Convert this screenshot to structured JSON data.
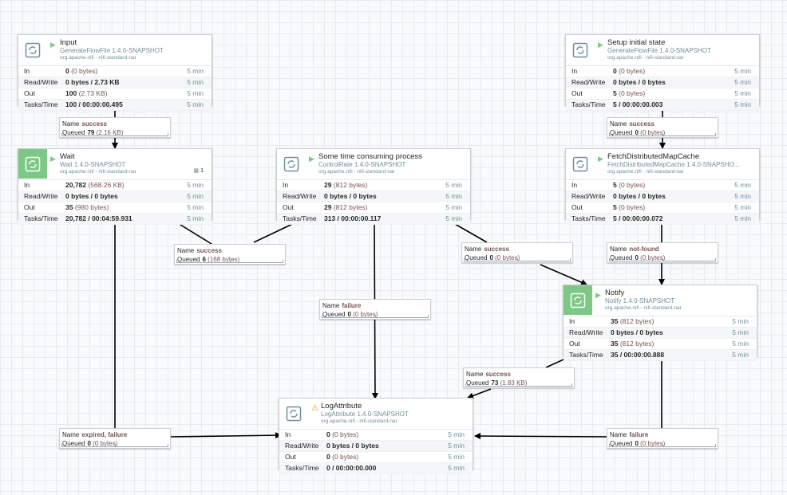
{
  "processors": {
    "input": {
      "name": "Input",
      "type": "GenerateFlowFile 1.4.0-SNAPSHOT",
      "bundle": "org.apache.nifi - nifi-standard-nar",
      "state": "running",
      "stats": [
        {
          "label": "In",
          "value": "0",
          "sub": "(0 bytes)",
          "time": "5 min"
        },
        {
          "label": "Read/Write",
          "value": "0 bytes / 2.73 KB",
          "sub": "",
          "time": "5 min"
        },
        {
          "label": "Out",
          "value": "100",
          "sub": "(2.73 KB)",
          "time": "5 min"
        },
        {
          "label": "Tasks/Time",
          "value": "100 / 00:00:00.495",
          "sub": "",
          "time": "5 min"
        }
      ]
    },
    "setup": {
      "name": "Setup initial state",
      "type": "GenerateFlowFile 1.4.0-SNAPSHOT",
      "bundle": "org.apache.nifi - nifi-standard-nar",
      "state": "running",
      "stats": [
        {
          "label": "In",
          "value": "0",
          "sub": "(0 bytes)",
          "time": "5 min"
        },
        {
          "label": "Read/Write",
          "value": "0 bytes / 0 bytes",
          "sub": "",
          "time": "5 min"
        },
        {
          "label": "Out",
          "value": "5",
          "sub": "(0 bytes)",
          "time": "5 min"
        },
        {
          "label": "Tasks/Time",
          "value": "5 / 00:00:00.003",
          "sub": "",
          "time": "5 min"
        }
      ]
    },
    "wait": {
      "name": "Wait",
      "type": "Wait 1.4.0-SNAPSHOT",
      "bundle": "org.apache.nifi - nifi-standard-nar",
      "state": "running",
      "badge": "1",
      "stats": [
        {
          "label": "In",
          "value": "20,782",
          "sub": "(568.26 KB)",
          "time": "5 min"
        },
        {
          "label": "Read/Write",
          "value": "0 bytes / 0 bytes",
          "sub": "",
          "time": "5 min"
        },
        {
          "label": "Out",
          "value": "35",
          "sub": "(980 bytes)",
          "time": "5 min"
        },
        {
          "label": "Tasks/Time",
          "value": "20,782 / 00:04:59.931",
          "sub": "",
          "time": "5 min"
        }
      ]
    },
    "consume": {
      "name": "Some time consuming process",
      "type": "ControlRate 1.4.0-SNAPSHOT",
      "bundle": "org.apache.nifi - nifi-standard-nar",
      "state": "running",
      "stats": [
        {
          "label": "In",
          "value": "29",
          "sub": "(812 bytes)",
          "time": "5 min"
        },
        {
          "label": "Read/Write",
          "value": "0 bytes / 0 bytes",
          "sub": "",
          "time": "5 min"
        },
        {
          "label": "Out",
          "value": "29",
          "sub": "(812 bytes)",
          "time": "5 min"
        },
        {
          "label": "Tasks/Time",
          "value": "313 / 00:00:00.117",
          "sub": "",
          "time": "5 min"
        }
      ]
    },
    "fetch": {
      "name": "FetchDistributedMapCache",
      "type": "FetchDistributedMapCache 1.4.0-SNAPSHO...",
      "bundle": "org.apache.nifi - nifi-standard-nar",
      "state": "running",
      "stats": [
        {
          "label": "In",
          "value": "5",
          "sub": "(0 bytes)",
          "time": "5 min"
        },
        {
          "label": "Read/Write",
          "value": "0 bytes / 0 bytes",
          "sub": "",
          "time": "5 min"
        },
        {
          "label": "Out",
          "value": "5",
          "sub": "(0 bytes)",
          "time": "5 min"
        },
        {
          "label": "Tasks/Time",
          "value": "5 / 00:00:00.072",
          "sub": "",
          "time": "5 min"
        }
      ]
    },
    "notify": {
      "name": "Notify",
      "type": "Notify 1.4.0-SNAPSHOT",
      "bundle": "org.apache.nifi - nifi-standard-nar",
      "state": "running",
      "stats": [
        {
          "label": "In",
          "value": "35",
          "sub": "(812 bytes)",
          "time": "5 min"
        },
        {
          "label": "Read/Write",
          "value": "0 bytes / 0 bytes",
          "sub": "",
          "time": "5 min"
        },
        {
          "label": "Out",
          "value": "35",
          "sub": "(812 bytes)",
          "time": "5 min"
        },
        {
          "label": "Tasks/Time",
          "value": "35 / 00:00:00.888",
          "sub": "",
          "time": "5 min"
        }
      ]
    },
    "log": {
      "name": "LogAttribute",
      "type": "LogAttribute 1.4.0-SNAPSHOT",
      "bundle": "org.apache.nifi - nifi-standard-nar",
      "state": "invalid",
      "stats": [
        {
          "label": "In",
          "value": "0",
          "sub": "(0 bytes)",
          "time": "5 min"
        },
        {
          "label": "Read/Write",
          "value": "0 bytes / 0 bytes",
          "sub": "",
          "time": "5 min"
        },
        {
          "label": "Out",
          "value": "0",
          "sub": "(0 bytes)",
          "time": "5 min"
        },
        {
          "label": "Tasks/Time",
          "value": "0 / 00:00:00.000",
          "sub": "",
          "time": "5 min"
        }
      ]
    }
  },
  "labels": {
    "name": "Name",
    "queued": "Queued"
  },
  "connections": {
    "input_wait": {
      "name": "success",
      "count": "79",
      "size": "(2.16 KB)"
    },
    "setup_fetch": {
      "name": "success",
      "count": "0",
      "size": "(0 bytes)"
    },
    "wait_consume": {
      "name": "success",
      "count": "6",
      "size": "(168 bytes)"
    },
    "consume_notify": {
      "name": "success",
      "count": "0",
      "size": "(0 bytes)"
    },
    "fetch_notify": {
      "name": "not-found",
      "count": "0",
      "size": "(0 bytes)"
    },
    "consume_log": {
      "name": "failure",
      "count": "0",
      "size": "(0 bytes)"
    },
    "notify_log": {
      "name": "success",
      "count": "73",
      "size": "(1.83 KB)"
    },
    "wait_log": {
      "name": "expired, failure",
      "count": "0",
      "size": "(0 bytes)"
    },
    "fetch_log": {
      "name": "failure",
      "count": "0",
      "size": "(0 bytes)"
    }
  },
  "colors": {
    "running": "#7dc886",
    "warning": "#cf9f14",
    "label": "#775351",
    "muted": "#728e9b"
  },
  "icons": {
    "processor": "processor-icon",
    "run": "play-icon",
    "warn": "warning-icon",
    "badge": "grid-icon"
  }
}
